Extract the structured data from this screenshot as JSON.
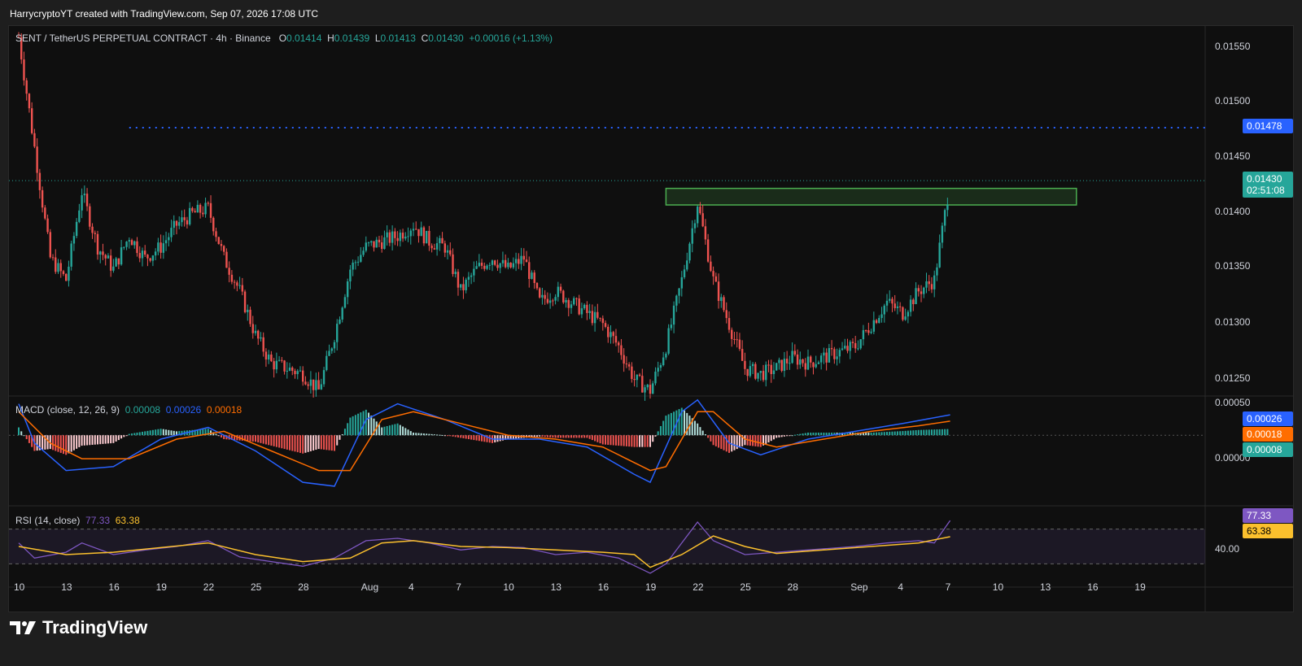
{
  "header": {
    "attribution": "HarrycryptoYT created with TradingView.com, Sep 07, 2026 17:08 UTC"
  },
  "legend": {
    "symbol": "SENT / TetherUS PERPETUAL CONTRACT · 4h · Binance",
    "o_label": "O",
    "o_value": "0.01414",
    "h_label": "H",
    "h_value": "0.01439",
    "l_label": "L",
    "l_value": "0.01413",
    "c_label": "C",
    "c_value": "0.01430",
    "change": "+0.00016 (+1.13%)"
  },
  "macd_legend": {
    "label": "MACD (close, 12, 26, 9)",
    "hist": "0.00008",
    "macd": "0.00026",
    "signal": "0.00018"
  },
  "rsi_legend": {
    "label": "RSI (14, close)",
    "rsi": "77.33",
    "ma": "63.38"
  },
  "price_axis": [
    "0.01550",
    "0.01500",
    "0.01450",
    "0.01400",
    "0.01350",
    "0.01300",
    "0.01250"
  ],
  "macd_axis": [
    "0.00050",
    "0.00000"
  ],
  "rsi_axis": [
    "40.00"
  ],
  "tags": {
    "level": "0.01478",
    "last_price": "0.01430",
    "countdown": "02:51:08",
    "macd_line": "0.00026",
    "signal_line": "0.00018",
    "histogram": "0.00008",
    "rsi": "77.33",
    "rsi_ma": "63.38"
  },
  "time_axis": [
    "10",
    "13",
    "16",
    "19",
    "22",
    "25",
    "28",
    "Aug",
    "4",
    "7",
    "10",
    "13",
    "16",
    "19",
    "22",
    "25",
    "28",
    "Sep",
    "4",
    "7",
    "10",
    "13",
    "16",
    "19"
  ],
  "colors": {
    "up": "#26a69a",
    "down": "#ef5350",
    "macd": "#2962ff",
    "signal": "#ff6d00",
    "rsi": "#7e57c2",
    "rsi_ma": "#fbc02d",
    "level_line": "#2962ff",
    "zone": "#4caf50"
  },
  "footer": {
    "brand": "TradingView"
  },
  "chart_data": {
    "type": "candlestick",
    "symbol": "SENT / TetherUS PERPETUAL CONTRACT",
    "interval": "4h",
    "exchange": "Binance",
    "ylim": [
      0.01235,
      0.0157
    ],
    "horizontal_level": 0.01478,
    "zone": {
      "low": 0.01408,
      "high": 0.01423,
      "from": "Aug 20",
      "to": "Sep 15"
    },
    "price_path": [
      {
        "x": "Jul 10",
        "y": 0.0156
      },
      {
        "x": "Jul 11",
        "y": 0.0146
      },
      {
        "x": "Jul 12",
        "y": 0.0136
      },
      {
        "x": "Jul 13",
        "y": 0.0134
      },
      {
        "x": "Jul 14",
        "y": 0.0142
      },
      {
        "x": "Jul 15",
        "y": 0.0137
      },
      {
        "x": "Jul 16",
        "y": 0.0135
      },
      {
        "x": "Jul 17",
        "y": 0.0138
      },
      {
        "x": "Jul 18",
        "y": 0.0136
      },
      {
        "x": "Jul 19",
        "y": 0.0137
      },
      {
        "x": "Jul 20",
        "y": 0.0139
      },
      {
        "x": "Jul 21",
        "y": 0.014
      },
      {
        "x": "Jul 22",
        "y": 0.01405
      },
      {
        "x": "Jul 23",
        "y": 0.0136
      },
      {
        "x": "Jul 24",
        "y": 0.0133
      },
      {
        "x": "Jul 25",
        "y": 0.0129
      },
      {
        "x": "Jul 26",
        "y": 0.01265
      },
      {
        "x": "Jul 27",
        "y": 0.0126
      },
      {
        "x": "Jul 28",
        "y": 0.01255
      },
      {
        "x": "Jul 29",
        "y": 0.0124
      },
      {
        "x": "Jul 30",
        "y": 0.0129
      },
      {
        "x": "Jul 31",
        "y": 0.0135
      },
      {
        "x": "Aug 1",
        "y": 0.0137
      },
      {
        "x": "Aug 2",
        "y": 0.01375
      },
      {
        "x": "Aug 3",
        "y": 0.0138
      },
      {
        "x": "Aug 4",
        "y": 0.0139
      },
      {
        "x": "Aug 5",
        "y": 0.01375
      },
      {
        "x": "Aug 6",
        "y": 0.0137
      },
      {
        "x": "Aug 7",
        "y": 0.0133
      },
      {
        "x": "Aug 8",
        "y": 0.0135
      },
      {
        "x": "Aug 9",
        "y": 0.0136
      },
      {
        "x": "Aug 10",
        "y": 0.0135
      },
      {
        "x": "Aug 11",
        "y": 0.0136
      },
      {
        "x": "Aug 12",
        "y": 0.0132
      },
      {
        "x": "Aug 13",
        "y": 0.0133
      },
      {
        "x": "Aug 14",
        "y": 0.0132
      },
      {
        "x": "Aug 15",
        "y": 0.0131
      },
      {
        "x": "Aug 16",
        "y": 0.013
      },
      {
        "x": "Aug 17",
        "y": 0.0128
      },
      {
        "x": "Aug 18",
        "y": 0.0125
      },
      {
        "x": "Aug 19",
        "y": 0.0124
      },
      {
        "x": "Aug 20",
        "y": 0.0128
      },
      {
        "x": "Aug 21",
        "y": 0.0134
      },
      {
        "x": "Aug 22",
        "y": 0.0141
      },
      {
        "x": "Aug 23",
        "y": 0.0134
      },
      {
        "x": "Aug 24",
        "y": 0.013
      },
      {
        "x": "Aug 25",
        "y": 0.0126
      },
      {
        "x": "Aug 26",
        "y": 0.01255
      },
      {
        "x": "Aug 27",
        "y": 0.0126
      },
      {
        "x": "Aug 28",
        "y": 0.0127
      },
      {
        "x": "Aug 29",
        "y": 0.01265
      },
      {
        "x": "Aug 30",
        "y": 0.0127
      },
      {
        "x": "Aug 31",
        "y": 0.01275
      },
      {
        "x": "Sep 1",
        "y": 0.0128
      },
      {
        "x": "Sep 2",
        "y": 0.013
      },
      {
        "x": "Sep 3",
        "y": 0.0132
      },
      {
        "x": "Sep 4",
        "y": 0.0131
      },
      {
        "x": "Sep 5",
        "y": 0.0133
      },
      {
        "x": "Sep 6",
        "y": 0.0134
      },
      {
        "x": "Sep 7",
        "y": 0.0143
      }
    ],
    "macd": {
      "params": "close, 12, 26, 9",
      "ylim": [
        -0.0009,
        0.0005
      ],
      "macd_path": [
        {
          "x": "Jul 10",
          "y": 0.0004
        },
        {
          "x": "Jul 11",
          "y": -0.0001
        },
        {
          "x": "Jul 13",
          "y": -0.00045
        },
        {
          "x": "Jul 16",
          "y": -0.0004
        },
        {
          "x": "Jul 19",
          "y": -5e-05
        },
        {
          "x": "Jul 22",
          "y": 0.0001
        },
        {
          "x": "Jul 25",
          "y": -0.0002
        },
        {
          "x": "Jul 28",
          "y": -0.0006
        },
        {
          "x": "Jul 30",
          "y": -0.00065
        },
        {
          "x": "Aug 1",
          "y": 0.0002
        },
        {
          "x": "Aug 3",
          "y": 0.0004
        },
        {
          "x": "Aug 6",
          "y": 0.0002
        },
        {
          "x": "Aug 9",
          "y": -5e-05
        },
        {
          "x": "Aug 12",
          "y": -5e-05
        },
        {
          "x": "Aug 15",
          "y": -0.00015
        },
        {
          "x": "Aug 18",
          "y": -0.0005
        },
        {
          "x": "Aug 19",
          "y": -0.0006
        },
        {
          "x": "Aug 21",
          "y": 0.0003
        },
        {
          "x": "Aug 22",
          "y": 0.00045
        },
        {
          "x": "Aug 24",
          "y": -0.0001
        },
        {
          "x": "Aug 26",
          "y": -0.00025
        },
        {
          "x": "Aug 29",
          "y": -5e-05
        },
        {
          "x": "Sep 1",
          "y": 5e-05
        },
        {
          "x": "Sep 4",
          "y": 0.00015
        },
        {
          "x": "Sep 7",
          "y": 0.00026
        }
      ],
      "signal_path": [
        {
          "x": "Jul 10",
          "y": 0.0003
        },
        {
          "x": "Jul 12",
          "y": -0.0001
        },
        {
          "x": "Jul 14",
          "y": -0.0003
        },
        {
          "x": "Jul 17",
          "y": -0.0003
        },
        {
          "x": "Jul 20",
          "y": -5e-05
        },
        {
          "x": "Jul 23",
          "y": 5e-05
        },
        {
          "x": "Jul 26",
          "y": -0.0002
        },
        {
          "x": "Jul 29",
          "y": -0.00045
        },
        {
          "x": "Jul 31",
          "y": -0.00045
        },
        {
          "x": "Aug 2",
          "y": 0.0002
        },
        {
          "x": "Aug 4",
          "y": 0.0003
        },
        {
          "x": "Aug 7",
          "y": 0.00015
        },
        {
          "x": "Aug 10",
          "y": 0.0
        },
        {
          "x": "Aug 13",
          "y": -5e-05
        },
        {
          "x": "Aug 16",
          "y": -0.00015
        },
        {
          "x": "Aug 19",
          "y": -0.00045
        },
        {
          "x": "Aug 20",
          "y": -0.0004
        },
        {
          "x": "Aug 22",
          "y": 0.0003
        },
        {
          "x": "Aug 23",
          "y": 0.0003
        },
        {
          "x": "Aug 25",
          "y": -5e-05
        },
        {
          "x": "Aug 27",
          "y": -0.00015
        },
        {
          "x": "Aug 30",
          "y": -5e-05
        },
        {
          "x": "Sep 2",
          "y": 5e-05
        },
        {
          "x": "Sep 5",
          "y": 0.00012
        },
        {
          "x": "Sep 7",
          "y": 0.00018
        }
      ],
      "histogram_last": 8e-05
    },
    "rsi": {
      "params": "14, close",
      "ylim": [
        20,
        90
      ],
      "bands": [
        70,
        40
      ],
      "rsi_path": [
        {
          "x": "Jul 10",
          "y": 58
        },
        {
          "x": "Jul 11",
          "y": 45
        },
        {
          "x": "Jul 13",
          "y": 50
        },
        {
          "x": "Jul 14",
          "y": 58
        },
        {
          "x": "Jul 16",
          "y": 48
        },
        {
          "x": "Jul 18",
          "y": 52
        },
        {
          "x": "Jul 20",
          "y": 55
        },
        {
          "x": "Jul 22",
          "y": 60
        },
        {
          "x": "Jul 24",
          "y": 46
        },
        {
          "x": "Jul 26",
          "y": 42
        },
        {
          "x": "Jul 28",
          "y": 38
        },
        {
          "x": "Jul 30",
          "y": 45
        },
        {
          "x": "Aug 1",
          "y": 60
        },
        {
          "x": "Aug 3",
          "y": 62
        },
        {
          "x": "Aug 5",
          "y": 58
        },
        {
          "x": "Aug 7",
          "y": 52
        },
        {
          "x": "Aug 9",
          "y": 55
        },
        {
          "x": "Aug 11",
          "y": 54
        },
        {
          "x": "Aug 13",
          "y": 48
        },
        {
          "x": "Aug 15",
          "y": 50
        },
        {
          "x": "Aug 17",
          "y": 45
        },
        {
          "x": "Aug 19",
          "y": 32
        },
        {
          "x": "Aug 20",
          "y": 40
        },
        {
          "x": "Aug 22",
          "y": 76
        },
        {
          "x": "Aug 23",
          "y": 60
        },
        {
          "x": "Aug 25",
          "y": 48
        },
        {
          "x": "Aug 27",
          "y": 50
        },
        {
          "x": "Aug 29",
          "y": 52
        },
        {
          "x": "Sep 1",
          "y": 55
        },
        {
          "x": "Sep 3",
          "y": 58
        },
        {
          "x": "Sep 5",
          "y": 60
        },
        {
          "x": "Sep 6",
          "y": 58
        },
        {
          "x": "Sep 7",
          "y": 77.33
        }
      ],
      "ma_path": [
        {
          "x": "Jul 10",
          "y": 55
        },
        {
          "x": "Jul 13",
          "y": 48
        },
        {
          "x": "Jul 16",
          "y": 50
        },
        {
          "x": "Jul 19",
          "y": 54
        },
        {
          "x": "Jul 22",
          "y": 58
        },
        {
          "x": "Jul 25",
          "y": 48
        },
        {
          "x": "Jul 28",
          "y": 42
        },
        {
          "x": "Jul 31",
          "y": 45
        },
        {
          "x": "Aug 2",
          "y": 58
        },
        {
          "x": "Aug 4",
          "y": 60
        },
        {
          "x": "Aug 7",
          "y": 55
        },
        {
          "x": "Aug 10",
          "y": 54
        },
        {
          "x": "Aug 13",
          "y": 52
        },
        {
          "x": "Aug 16",
          "y": 50
        },
        {
          "x": "Aug 18",
          "y": 48
        },
        {
          "x": "Aug 19",
          "y": 37
        },
        {
          "x": "Aug 21",
          "y": 48
        },
        {
          "x": "Aug 23",
          "y": 64
        },
        {
          "x": "Aug 25",
          "y": 55
        },
        {
          "x": "Aug 27",
          "y": 49
        },
        {
          "x": "Aug 30",
          "y": 52
        },
        {
          "x": "Sep 2",
          "y": 55
        },
        {
          "x": "Sep 5",
          "y": 58
        },
        {
          "x": "Sep 7",
          "y": 63.38
        }
      ]
    }
  }
}
